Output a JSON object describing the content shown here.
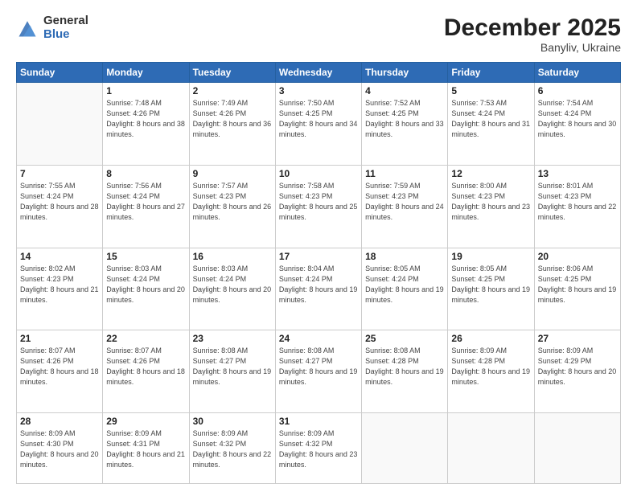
{
  "header": {
    "logo_general": "General",
    "logo_blue": "Blue",
    "month_title": "December 2025",
    "location": "Banyliv, Ukraine"
  },
  "days_of_week": [
    "Sunday",
    "Monday",
    "Tuesday",
    "Wednesday",
    "Thursday",
    "Friday",
    "Saturday"
  ],
  "weeks": [
    [
      {
        "day": "",
        "info": ""
      },
      {
        "day": "1",
        "info": "Sunrise: 7:48 AM\nSunset: 4:26 PM\nDaylight: 8 hours\nand 38 minutes."
      },
      {
        "day": "2",
        "info": "Sunrise: 7:49 AM\nSunset: 4:26 PM\nDaylight: 8 hours\nand 36 minutes."
      },
      {
        "day": "3",
        "info": "Sunrise: 7:50 AM\nSunset: 4:25 PM\nDaylight: 8 hours\nand 34 minutes."
      },
      {
        "day": "4",
        "info": "Sunrise: 7:52 AM\nSunset: 4:25 PM\nDaylight: 8 hours\nand 33 minutes."
      },
      {
        "day": "5",
        "info": "Sunrise: 7:53 AM\nSunset: 4:24 PM\nDaylight: 8 hours\nand 31 minutes."
      },
      {
        "day": "6",
        "info": "Sunrise: 7:54 AM\nSunset: 4:24 PM\nDaylight: 8 hours\nand 30 minutes."
      }
    ],
    [
      {
        "day": "7",
        "info": "Sunrise: 7:55 AM\nSunset: 4:24 PM\nDaylight: 8 hours\nand 28 minutes."
      },
      {
        "day": "8",
        "info": "Sunrise: 7:56 AM\nSunset: 4:24 PM\nDaylight: 8 hours\nand 27 minutes."
      },
      {
        "day": "9",
        "info": "Sunrise: 7:57 AM\nSunset: 4:23 PM\nDaylight: 8 hours\nand 26 minutes."
      },
      {
        "day": "10",
        "info": "Sunrise: 7:58 AM\nSunset: 4:23 PM\nDaylight: 8 hours\nand 25 minutes."
      },
      {
        "day": "11",
        "info": "Sunrise: 7:59 AM\nSunset: 4:23 PM\nDaylight: 8 hours\nand 24 minutes."
      },
      {
        "day": "12",
        "info": "Sunrise: 8:00 AM\nSunset: 4:23 PM\nDaylight: 8 hours\nand 23 minutes."
      },
      {
        "day": "13",
        "info": "Sunrise: 8:01 AM\nSunset: 4:23 PM\nDaylight: 8 hours\nand 22 minutes."
      }
    ],
    [
      {
        "day": "14",
        "info": "Sunrise: 8:02 AM\nSunset: 4:23 PM\nDaylight: 8 hours\nand 21 minutes."
      },
      {
        "day": "15",
        "info": "Sunrise: 8:03 AM\nSunset: 4:24 PM\nDaylight: 8 hours\nand 20 minutes."
      },
      {
        "day": "16",
        "info": "Sunrise: 8:03 AM\nSunset: 4:24 PM\nDaylight: 8 hours\nand 20 minutes."
      },
      {
        "day": "17",
        "info": "Sunrise: 8:04 AM\nSunset: 4:24 PM\nDaylight: 8 hours\nand 19 minutes."
      },
      {
        "day": "18",
        "info": "Sunrise: 8:05 AM\nSunset: 4:24 PM\nDaylight: 8 hours\nand 19 minutes."
      },
      {
        "day": "19",
        "info": "Sunrise: 8:05 AM\nSunset: 4:25 PM\nDaylight: 8 hours\nand 19 minutes."
      },
      {
        "day": "20",
        "info": "Sunrise: 8:06 AM\nSunset: 4:25 PM\nDaylight: 8 hours\nand 19 minutes."
      }
    ],
    [
      {
        "day": "21",
        "info": "Sunrise: 8:07 AM\nSunset: 4:26 PM\nDaylight: 8 hours\nand 18 minutes."
      },
      {
        "day": "22",
        "info": "Sunrise: 8:07 AM\nSunset: 4:26 PM\nDaylight: 8 hours\nand 18 minutes."
      },
      {
        "day": "23",
        "info": "Sunrise: 8:08 AM\nSunset: 4:27 PM\nDaylight: 8 hours\nand 19 minutes."
      },
      {
        "day": "24",
        "info": "Sunrise: 8:08 AM\nSunset: 4:27 PM\nDaylight: 8 hours\nand 19 minutes."
      },
      {
        "day": "25",
        "info": "Sunrise: 8:08 AM\nSunset: 4:28 PM\nDaylight: 8 hours\nand 19 minutes."
      },
      {
        "day": "26",
        "info": "Sunrise: 8:09 AM\nSunset: 4:28 PM\nDaylight: 8 hours\nand 19 minutes."
      },
      {
        "day": "27",
        "info": "Sunrise: 8:09 AM\nSunset: 4:29 PM\nDaylight: 8 hours\nand 20 minutes."
      }
    ],
    [
      {
        "day": "28",
        "info": "Sunrise: 8:09 AM\nSunset: 4:30 PM\nDaylight: 8 hours\nand 20 minutes."
      },
      {
        "day": "29",
        "info": "Sunrise: 8:09 AM\nSunset: 4:31 PM\nDaylight: 8 hours\nand 21 minutes."
      },
      {
        "day": "30",
        "info": "Sunrise: 8:09 AM\nSunset: 4:32 PM\nDaylight: 8 hours\nand 22 minutes."
      },
      {
        "day": "31",
        "info": "Sunrise: 8:09 AM\nSunset: 4:32 PM\nDaylight: 8 hours\nand 23 minutes."
      },
      {
        "day": "",
        "info": ""
      },
      {
        "day": "",
        "info": ""
      },
      {
        "day": "",
        "info": ""
      }
    ]
  ]
}
